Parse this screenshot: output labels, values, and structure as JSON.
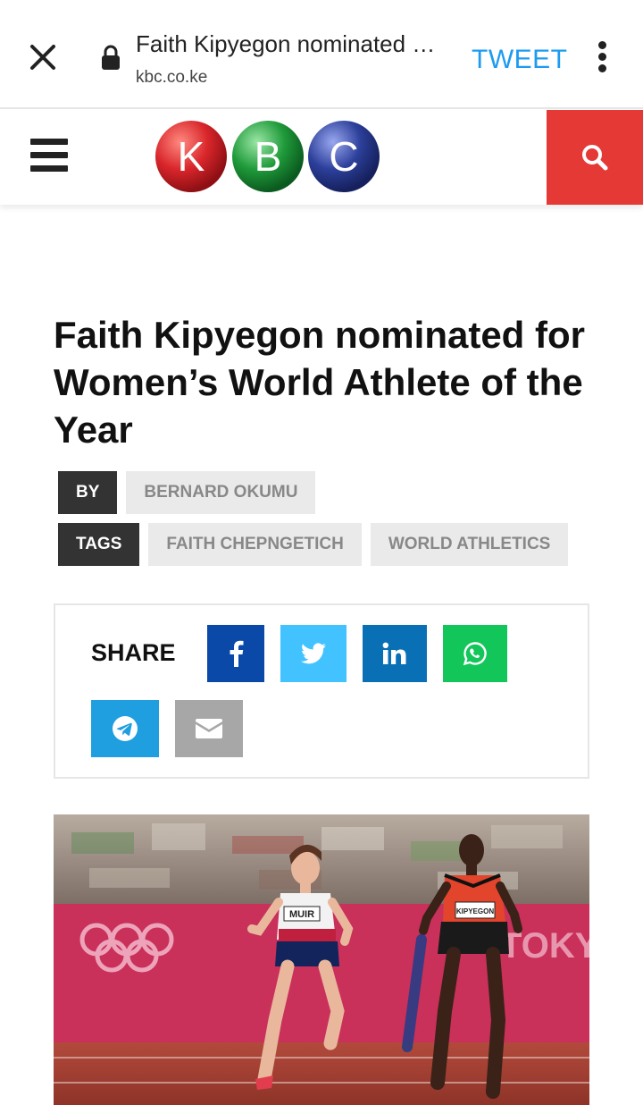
{
  "browser": {
    "title": "Faith Kipyegon nominated …",
    "domain": "kbc.co.ke",
    "tweet_label": "TWEET"
  },
  "site": {
    "logo_letters": [
      "K",
      "B",
      "C"
    ],
    "logo_colors": [
      "#d9262b",
      "#1f9a3a",
      "#2c3f9a"
    ],
    "search_bg": "#e53935"
  },
  "article": {
    "headline": "Faith Kipyegon nominated for Women’s World Athlete of the Year",
    "by_label": "BY",
    "author": "BERNARD OKUMU",
    "tags_label": "TAGS",
    "tags": [
      "FAITH CHEPNGETICH",
      "WORLD ATHLETICS"
    ],
    "share_label": "SHARE",
    "share_buttons": [
      "facebook-icon",
      "twitter-icon",
      "linkedin-icon",
      "whatsapp-icon",
      "telegram-icon",
      "email-icon"
    ],
    "photo_bibs": [
      "MUIR",
      "KIPYEGON"
    ],
    "photo_text": "TOKYO"
  }
}
